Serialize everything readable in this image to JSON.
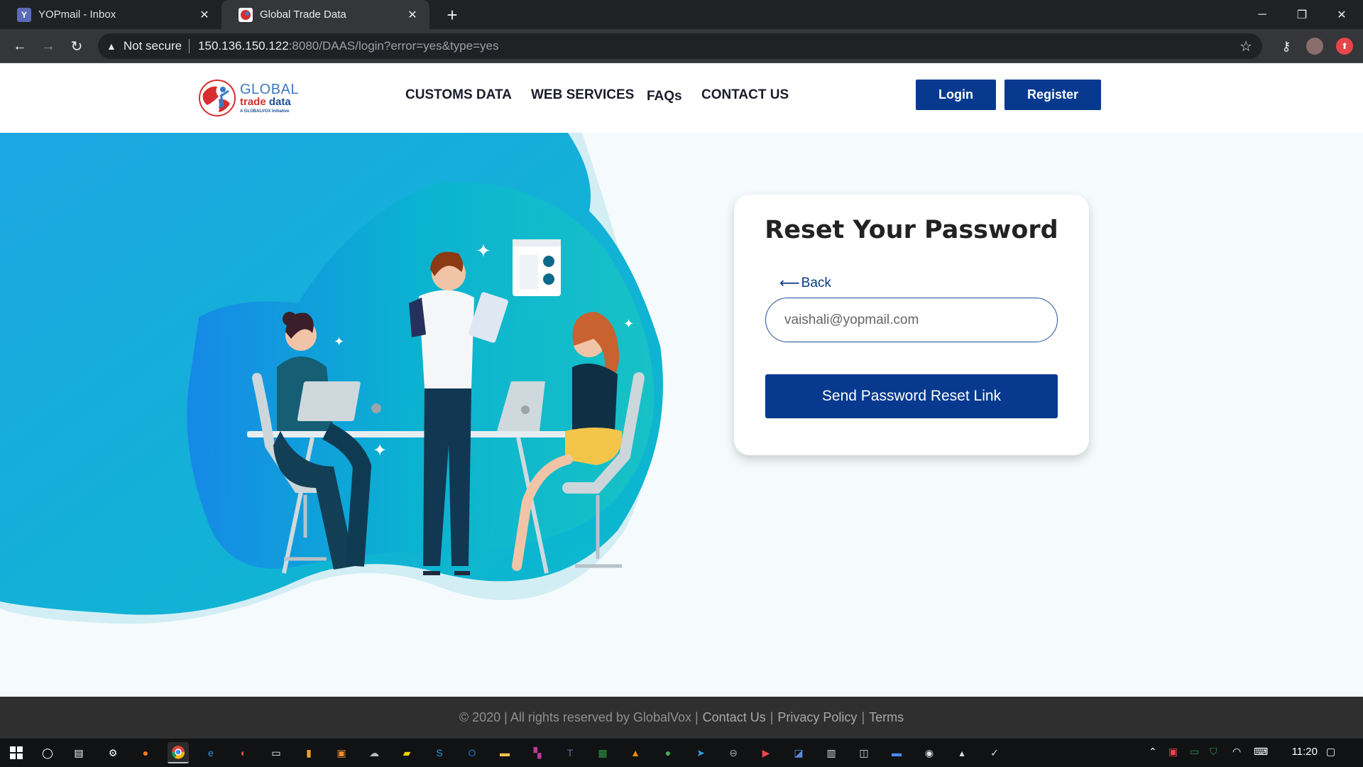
{
  "browser": {
    "tabs": [
      {
        "title": "YOPmail - Inbox",
        "favicon": "Y"
      },
      {
        "title": "Global Trade Data",
        "favicon": "globe-favicon"
      }
    ],
    "security_label": "Not secure",
    "url_host": "150.136.150.122",
    "url_path": ":8080/DAAS/login?error=yes&type=yes"
  },
  "site": {
    "logo": {
      "line1": "GLOBAL",
      "line2a": "trade ",
      "line2b": "data",
      "line3": "A GLOBALVOX Initiative"
    },
    "nav": [
      "CUSTOMS DATA",
      "WEB SERVICES",
      "FAQs",
      "CONTACT US"
    ],
    "login_label": "Login",
    "register_label": "Register"
  },
  "reset": {
    "heading": "Reset Your Password",
    "back_label": "Back",
    "email_value": "vaishali@yopmail.com",
    "button_label": "Send Password Reset Link"
  },
  "footer": {
    "copyright": "© 2020 | All rights reserved by GlobalVox |",
    "contact": "Contact Us",
    "sep1": "|",
    "privacy": "Privacy Policy",
    "sep2": "|",
    "terms": "Terms"
  },
  "taskbar": {
    "clock": "11:20"
  },
  "colors": {
    "primary": "#073a8f",
    "hero_teal": "#0bb6cf",
    "footer_bg": "#2f2f2f"
  }
}
